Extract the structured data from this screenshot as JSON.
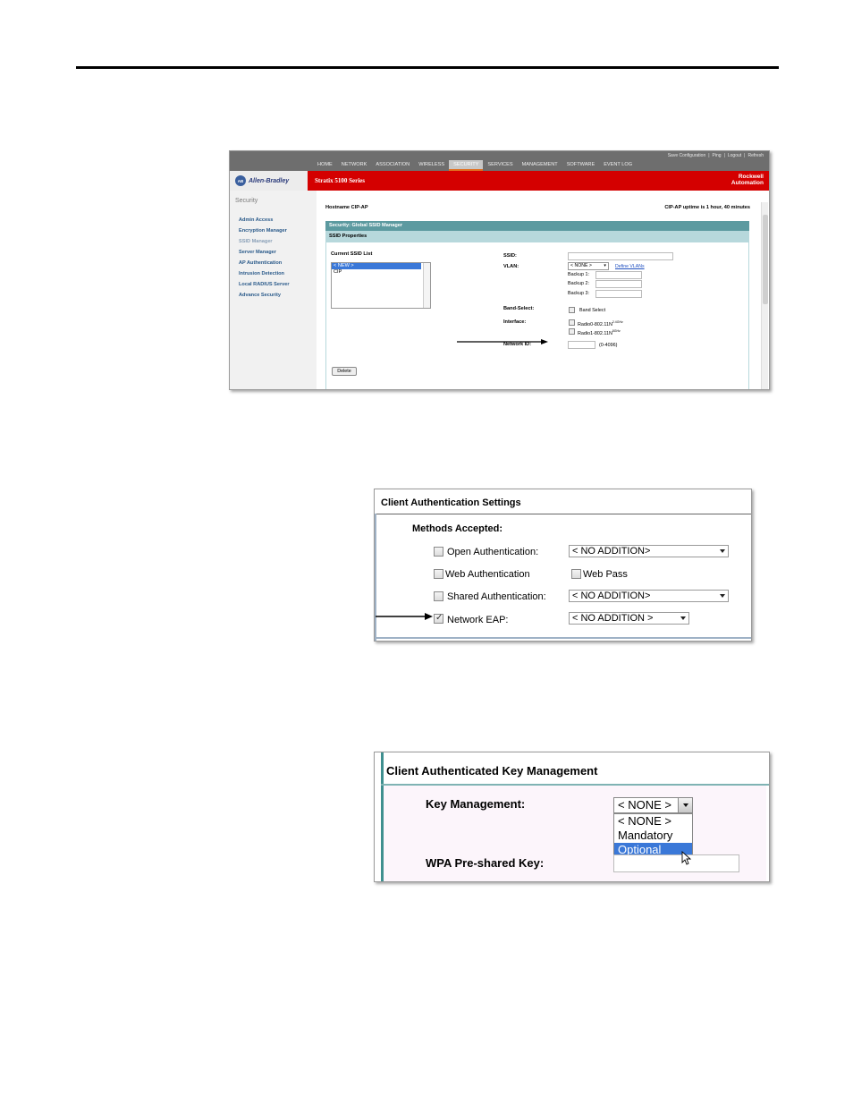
{
  "screen1": {
    "top_links": [
      "Save Configuration",
      "Ping",
      "Logout",
      "Refresh"
    ],
    "nav": [
      "HOME",
      "NETWORK",
      "ASSOCIATION",
      "WIRELESS",
      "SECURITY",
      "SERVICES",
      "MANAGEMENT",
      "SOFTWARE",
      "EVENT LOG"
    ],
    "active_nav": "SECURITY",
    "brand_logo_text": "Allen-Bradley",
    "product": "Stratix 5100 Series",
    "rockwell_line1": "Rockwell",
    "rockwell_line2": "Automation",
    "sidebar_title": "Security",
    "sidebar_items": [
      "Admin Access",
      "Encryption Manager",
      "SSID Manager",
      "Server Manager",
      "AP Authentication",
      "Intrusion Detection",
      "Local RADIUS Server",
      "Advance Security"
    ],
    "hostname": "Hostname  CIP-AP",
    "uptime": "CIP-AP uptime is 1 hour, 40 minutes",
    "section_bar": "Security: Global SSID Manager",
    "subsection_bar": "SSID Properties",
    "current_ssid_list_label": "Current SSID List",
    "ssid_list": [
      "< NEW >",
      "CIP"
    ],
    "ssid_label": "SSID:",
    "vlan_label": "VLAN:",
    "vlan_value": "< NONE >",
    "define_vlans": "Define VLANs",
    "backup1": "Backup 1:",
    "backup2": "Backup 2:",
    "backup3": "Backup 3:",
    "band_select_label": "Band-Select:",
    "band_select_option": "Band Select",
    "interface_label": "Interface:",
    "radio0": "Radio0-802.11N",
    "radio0_sup": "2.4GHz",
    "radio1": "Radio1-802.11N",
    "radio1_sup": "5GHz",
    "network_id_label": "Network ID:",
    "network_id_range": "(0-4096)",
    "delete_button": "Delete"
  },
  "screen2": {
    "title": "Client Authentication Settings",
    "methods_accepted": "Methods Accepted:",
    "open_auth": "Open Authentication:",
    "open_auth_select": "< NO ADDITION>",
    "web_auth": "Web Authentication",
    "web_pass": "Web Pass",
    "shared_auth": "Shared Authentication:",
    "shared_auth_select": "< NO ADDITION>",
    "network_eap": "Network EAP:",
    "network_eap_checked": true,
    "network_eap_select": "< NO ADDITION >"
  },
  "screen3": {
    "title": "Client Authenticated Key Management",
    "key_management_label": "Key Management:",
    "key_management_value": "< NONE >",
    "key_management_options": [
      "< NONE >",
      "Mandatory",
      "Optional"
    ],
    "highlighted_option": "Optional",
    "wpa_psk_label": "WPA Pre-shared Key:"
  }
}
